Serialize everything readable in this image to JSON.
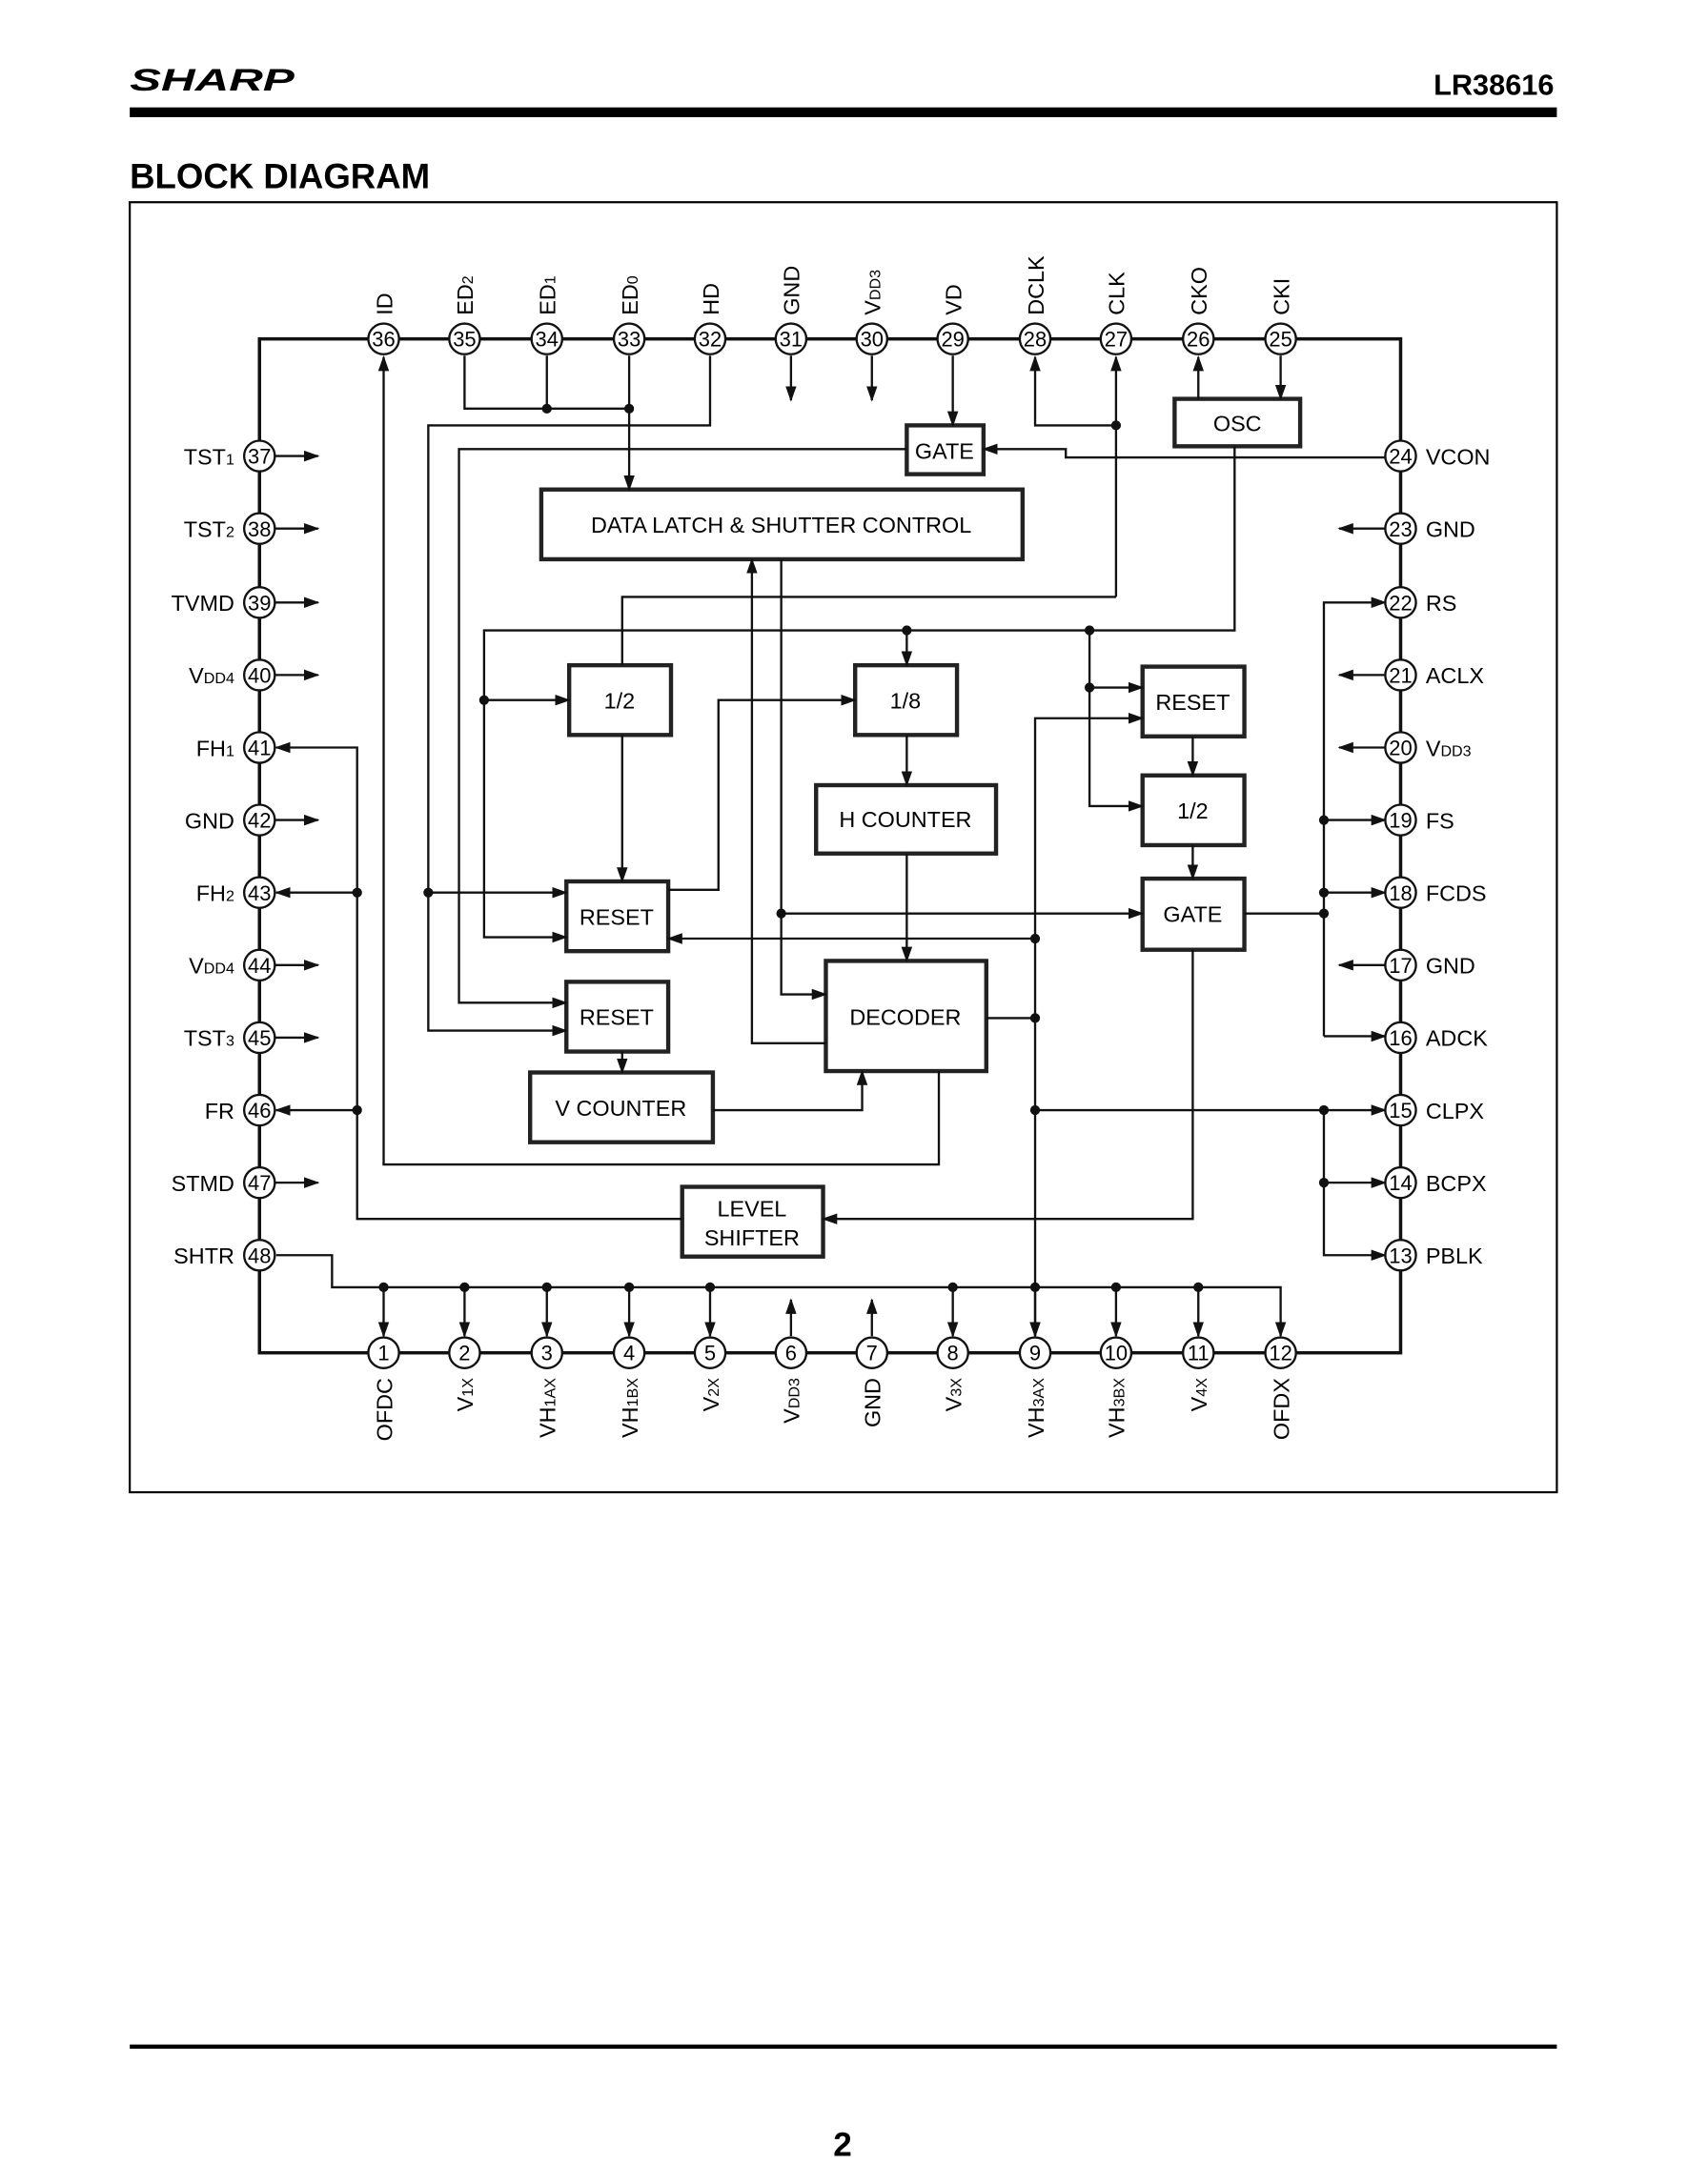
{
  "header": {
    "brand": "SHARP",
    "part_number": "LR38616"
  },
  "section_title": "BLOCK DIAGRAM",
  "footer": {
    "page_number": "2"
  },
  "pins": {
    "top": [
      {
        "num": "36",
        "name": "ID",
        "sub": ""
      },
      {
        "num": "35",
        "name": "ED",
        "sub": "2"
      },
      {
        "num": "34",
        "name": "ED",
        "sub": "1"
      },
      {
        "num": "33",
        "name": "ED",
        "sub": "0"
      },
      {
        "num": "32",
        "name": "HD",
        "sub": ""
      },
      {
        "num": "31",
        "name": "GND",
        "sub": ""
      },
      {
        "num": "30",
        "name": "V",
        "sub": "DD3"
      },
      {
        "num": "29",
        "name": "VD",
        "sub": ""
      },
      {
        "num": "28",
        "name": "DCLK",
        "sub": ""
      },
      {
        "num": "27",
        "name": "CLK",
        "sub": ""
      },
      {
        "num": "26",
        "name": "CKO",
        "sub": ""
      },
      {
        "num": "25",
        "name": "CKI",
        "sub": ""
      }
    ],
    "left": [
      {
        "num": "37",
        "name": "TST",
        "sub": "1"
      },
      {
        "num": "38",
        "name": "TST",
        "sub": "2"
      },
      {
        "num": "39",
        "name": "TVMD",
        "sub": ""
      },
      {
        "num": "40",
        "name": "V",
        "sub": "DD4"
      },
      {
        "num": "41",
        "name": "FH",
        "sub": "1"
      },
      {
        "num": "42",
        "name": "GND",
        "sub": ""
      },
      {
        "num": "43",
        "name": "FH",
        "sub": "2"
      },
      {
        "num": "44",
        "name": "V",
        "sub": "DD4"
      },
      {
        "num": "45",
        "name": "TST",
        "sub": "3"
      },
      {
        "num": "46",
        "name": "FR",
        "sub": ""
      },
      {
        "num": "47",
        "name": "STMD",
        "sub": ""
      },
      {
        "num": "48",
        "name": "SHTR",
        "sub": ""
      }
    ],
    "right": [
      {
        "num": "24",
        "name": "VCON",
        "sub": ""
      },
      {
        "num": "23",
        "name": "GND",
        "sub": ""
      },
      {
        "num": "22",
        "name": "RS",
        "sub": ""
      },
      {
        "num": "21",
        "name": "ACLX",
        "sub": ""
      },
      {
        "num": "20",
        "name": "V",
        "sub": "DD3"
      },
      {
        "num": "19",
        "name": "FS",
        "sub": ""
      },
      {
        "num": "18",
        "name": "FCDS",
        "sub": ""
      },
      {
        "num": "17",
        "name": "GND",
        "sub": ""
      },
      {
        "num": "16",
        "name": "ADCK",
        "sub": ""
      },
      {
        "num": "15",
        "name": "CLPX",
        "sub": ""
      },
      {
        "num": "14",
        "name": "BCPX",
        "sub": ""
      },
      {
        "num": "13",
        "name": "PBLK",
        "sub": ""
      }
    ],
    "bottom": [
      {
        "num": "1",
        "name": "OFDC",
        "sub": ""
      },
      {
        "num": "2",
        "name": "V",
        "sub": "1X"
      },
      {
        "num": "3",
        "name": "VH",
        "sub": "1AX"
      },
      {
        "num": "4",
        "name": "VH",
        "sub": "1BX"
      },
      {
        "num": "5",
        "name": "V",
        "sub": "2X"
      },
      {
        "num": "6",
        "name": "V",
        "sub": "DD3"
      },
      {
        "num": "7",
        "name": "GND",
        "sub": ""
      },
      {
        "num": "8",
        "name": "V",
        "sub": "3X"
      },
      {
        "num": "9",
        "name": "VH",
        "sub": "3AX"
      },
      {
        "num": "10",
        "name": "VH",
        "sub": "3BX"
      },
      {
        "num": "11",
        "name": "V",
        "sub": "4X"
      },
      {
        "num": "12",
        "name": "OFDX",
        "sub": ""
      }
    ]
  },
  "blocks": {
    "gate_top": "GATE",
    "osc": "OSC",
    "data_latch": "DATA LATCH & SHUTTER CONTROL",
    "div2_left": "1/2",
    "div8": "1/8",
    "h_counter": "H COUNTER",
    "reset_right": "RESET",
    "div2_right": "1/2",
    "gate_right": "GATE",
    "reset_mid1": "RESET",
    "reset_mid2": "RESET",
    "decoder": "DECODER",
    "v_counter": "V COUNTER",
    "level_shifter_1": "LEVEL",
    "level_shifter_2": "SHIFTER"
  }
}
